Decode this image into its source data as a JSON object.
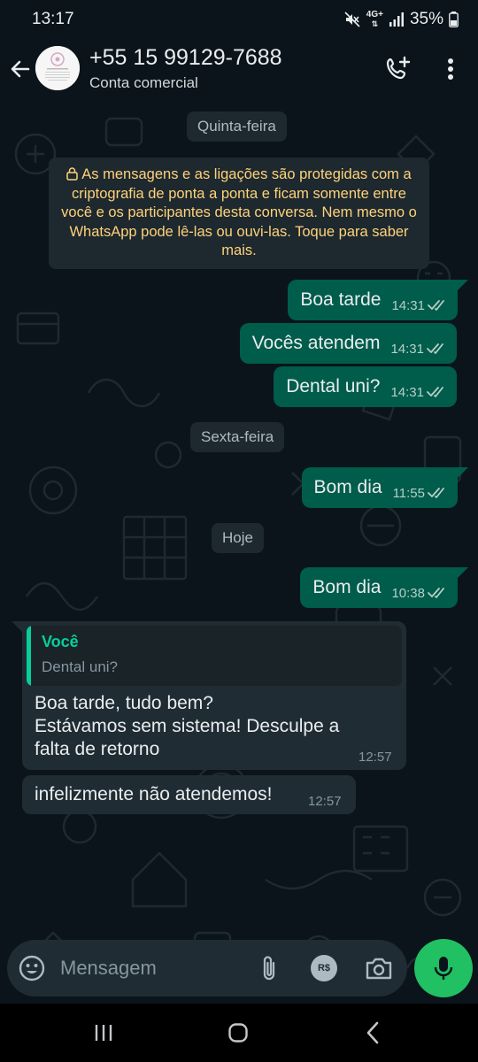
{
  "status_bar": {
    "time": "13:17",
    "network": "4G+",
    "battery": "35%",
    "icons": [
      "mute-icon",
      "network-4g-icon",
      "signal-icon",
      "battery-icon"
    ]
  },
  "header": {
    "contact_name": "+55 15 99129-7688",
    "subtitle": "Conta comercial",
    "icons": [
      "back-arrow-icon",
      "add-call-icon",
      "more-vert-icon"
    ]
  },
  "chat": {
    "date_thursday": "Quinta-feira",
    "encryption_note": "As mensagens e as ligações são protegidas com a criptografia de ponta a ponta e ficam somente entre você e os participantes desta conversa. Nem mesmo o WhatsApp pode lê-las ou ouvi-las. Toque para saber mais.",
    "date_friday": "Sexta-feira",
    "date_today": "Hoje",
    "messages": [
      {
        "direction": "out",
        "text": "Boa tarde",
        "time": "14:31",
        "status": "read"
      },
      {
        "direction": "out",
        "text": "Vocês atendem",
        "time": "14:31",
        "status": "read"
      },
      {
        "direction": "out",
        "text": "Dental uni?",
        "time": "14:31",
        "status": "read"
      },
      {
        "direction": "out",
        "text": "Bom dia",
        "time": "11:55",
        "status": "read"
      },
      {
        "direction": "out",
        "text": "Bom dia",
        "time": "10:38",
        "status": "read"
      },
      {
        "direction": "in",
        "quote": {
          "author": "Você",
          "text": "Dental uni?"
        },
        "lines": [
          "Boa tarde, tudo bem?",
          "Estávamos sem sistema! Desculpe a",
          "falta de retorno"
        ],
        "time": "12:57"
      },
      {
        "direction": "in",
        "text": "infelizmente não atendemos!",
        "time": "12:57"
      }
    ]
  },
  "input_bar": {
    "placeholder": "Mensagem",
    "payment_label": "R$",
    "icons": [
      "emoji-icon",
      "attach-icon",
      "payment-icon",
      "camera-icon",
      "mic-icon"
    ]
  },
  "nav_bar": {
    "icons": [
      "recents-icon",
      "home-icon",
      "nav-back-icon"
    ]
  },
  "colors": {
    "background": "#0b141a",
    "outgoing_bubble": "#005c4b",
    "incoming_bubble": "#202c33",
    "accent": "#21c063",
    "quote_accent": "#06cf9c",
    "encryption_text": "#ffd279",
    "read_ticks": "#b7cfc7"
  }
}
